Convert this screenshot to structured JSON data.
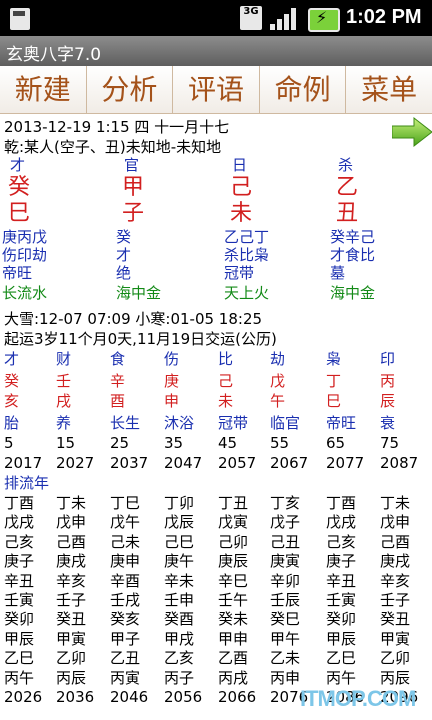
{
  "status": {
    "time": "1:02 PM",
    "network": "3G"
  },
  "app_title": "玄奥八字7.0",
  "menu": [
    "新建",
    "分析",
    "评语",
    "命例",
    "菜单"
  ],
  "date_line": "2013-12-19 1:15  四  十一月十七",
  "person_line": "乾:某人(空子、丑)未知地-未知地",
  "pillars": [
    {
      "shen": "才",
      "gan": "癸",
      "zhi": "巳",
      "hidden1": "庚丙戊",
      "hidden2": "伤印劫",
      "stage": "帝旺",
      "nayin": "长流水"
    },
    {
      "shen": "官",
      "gan": "甲",
      "zhi": "子",
      "hidden1": "癸",
      "hidden2": "才",
      "stage": "绝",
      "nayin": "海中金"
    },
    {
      "shen": "日",
      "gan": "己",
      "zhi": "未",
      "hidden1": "乙己丁",
      "hidden2": "杀比枭",
      "stage": "冠带",
      "nayin": "天上火"
    },
    {
      "shen": "杀",
      "gan": "乙",
      "zhi": "丑",
      "hidden1": "癸辛己",
      "hidden2": "才食比",
      "stage": "墓",
      "nayin": "海中金"
    }
  ],
  "jieqi_line": "大雪:12-07 07:09  小寒:01-05 18:25",
  "qiyun_line": "起运3岁11个月0天,11月19日交运(公历)",
  "dayun": [
    {
      "shen": "才",
      "gan": "癸",
      "zhi": "亥",
      "stage": "胎",
      "age": "5",
      "year": "2017"
    },
    {
      "shen": "财",
      "gan": "壬",
      "zhi": "戌",
      "stage": "养",
      "age": "15",
      "year": "2027"
    },
    {
      "shen": "食",
      "gan": "辛",
      "zhi": "酉",
      "stage": "长生",
      "age": "25",
      "year": "2037"
    },
    {
      "shen": "伤",
      "gan": "庚",
      "zhi": "申",
      "stage": "沐浴",
      "age": "35",
      "year": "2047"
    },
    {
      "shen": "比",
      "gan": "己",
      "zhi": "未",
      "stage": "冠带",
      "age": "45",
      "year": "2057"
    },
    {
      "shen": "劫",
      "gan": "戊",
      "zhi": "午",
      "stage": "临官",
      "age": "55",
      "year": "2067"
    },
    {
      "shen": "枭",
      "gan": "丁",
      "zhi": "巳",
      "stage": "帝旺",
      "age": "65",
      "year": "2077"
    },
    {
      "shen": "印",
      "gan": "丙",
      "zhi": "辰",
      "stage": "衰",
      "age": "75",
      "year": "2087"
    }
  ],
  "liunian_label": "排流年",
  "liunian": [
    [
      "丁酉",
      "戊戌",
      "己亥",
      "庚子",
      "辛丑",
      "壬寅",
      "癸卯",
      "甲辰",
      "乙巳",
      "丙午"
    ],
    [
      "丁未",
      "戊申",
      "己酉",
      "庚戌",
      "辛亥",
      "壬子",
      "癸丑",
      "甲寅",
      "乙卯",
      "丙辰"
    ],
    [
      "丁巳",
      "戊午",
      "己未",
      "庚申",
      "辛酉",
      "壬戌",
      "癸亥",
      "甲子",
      "乙丑",
      "丙寅"
    ],
    [
      "丁卯",
      "戊辰",
      "己巳",
      "庚午",
      "辛未",
      "壬申",
      "癸酉",
      "甲戌",
      "乙亥",
      "丙子"
    ],
    [
      "丁丑",
      "戊寅",
      "己卯",
      "庚辰",
      "辛巳",
      "壬午",
      "癸未",
      "甲申",
      "乙酉",
      "丙戌"
    ],
    [
      "丁亥",
      "戊子",
      "己丑",
      "庚寅",
      "辛卯",
      "壬辰",
      "癸巳",
      "甲午",
      "乙未",
      "丙申"
    ],
    [
      "丁酉",
      "戊戌",
      "己亥",
      "庚子",
      "辛丑",
      "壬寅",
      "癸卯",
      "甲辰",
      "乙巳",
      "丙午"
    ],
    [
      "丁未",
      "戊申",
      "己酉",
      "庚戌",
      "辛亥",
      "壬子",
      "癸丑",
      "甲寅",
      "乙卯",
      "丙辰"
    ]
  ],
  "liunian_end_years": [
    "2026",
    "2036",
    "2046",
    "2056",
    "2066",
    "2076",
    "2086",
    "2096"
  ],
  "watermark": "ITMOP.COM"
}
